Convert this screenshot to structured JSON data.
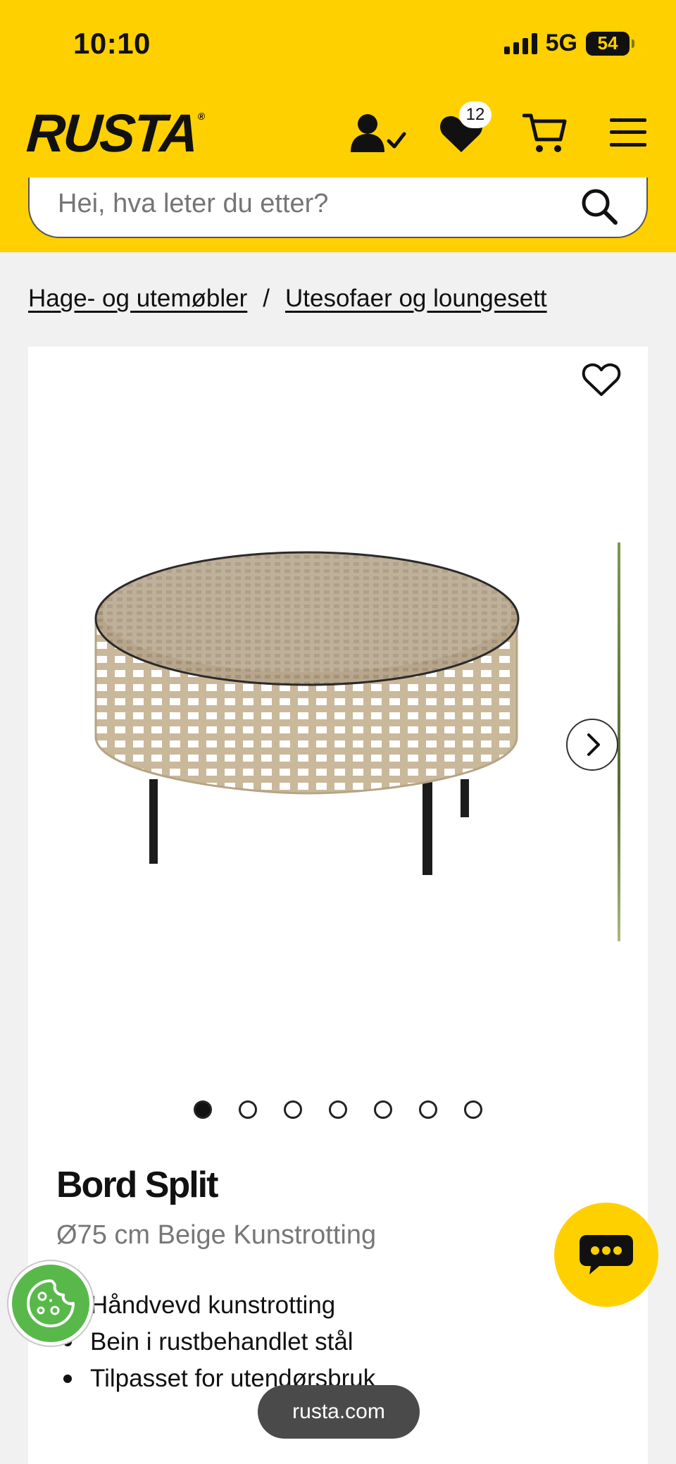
{
  "status": {
    "time": "10:10",
    "network": "5G",
    "battery": "54"
  },
  "header": {
    "logo": "RUSTA",
    "logo_mark": "®",
    "wishlist_count": "12",
    "icons": [
      "account-check-icon",
      "heart-icon",
      "cart-icon",
      "menu-icon"
    ]
  },
  "search": {
    "placeholder": "Hei, hva leter du etter?"
  },
  "breadcrumb": {
    "items": [
      "Hage- og utemøbler",
      "Utesofaer og loungesett"
    ],
    "separator": "/"
  },
  "product": {
    "title": "Bord Split",
    "subtitle": "Ø75 cm Beige Kunstrotting",
    "features": [
      "Håndvevd kunstrotting",
      "Bein i rustbehandlet stål",
      "Tilpasset for utendørsbruk"
    ],
    "image_count": 7,
    "active_image": 1
  },
  "browser": {
    "url": "rusta.com"
  },
  "colors": {
    "brand": "#ffd000",
    "cookie": "#58b94a"
  }
}
